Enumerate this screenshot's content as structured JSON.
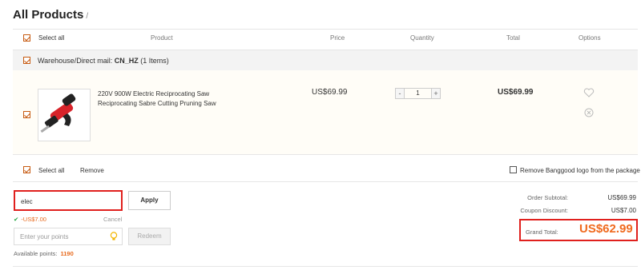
{
  "page": {
    "title": "All Products",
    "title_sep": "/"
  },
  "table_header": {
    "select_all": "Select all",
    "product": "Product",
    "price": "Price",
    "quantity": "Quantity",
    "total": "Total",
    "options": "Options"
  },
  "warehouse": {
    "prefix": "Warehouse/Direct mail: ",
    "code": "CN_HZ",
    "count": "(1 Items)"
  },
  "item": {
    "name": "220V 900W Electric Reciprocating Saw Reciprocating Sabre Cutting Pruning Saw",
    "price": "US$69.99",
    "quantity": "1",
    "total": "US$69.99",
    "minus": "-",
    "plus": "+"
  },
  "bottom_bar": {
    "select_all": "Select all",
    "remove": "Remove",
    "remove_logo": "Remove Banggood logo from the package"
  },
  "coupon": {
    "value": "elec",
    "apply": "Apply",
    "discount": "-US$7.00",
    "cancel": "Cancel"
  },
  "points": {
    "placeholder": "Enter your points",
    "redeem": "Redeem",
    "available_label": "Available points:",
    "available_value": "1190"
  },
  "summary": {
    "subtotal_label": "Order Subtotal:",
    "subtotal_value": "US$69.99",
    "coupon_label": "Coupon Discount:",
    "coupon_value": "US$7.00",
    "grand_label": "Grand Total:",
    "grand_value": "US$62.99"
  },
  "colors": {
    "accent_orange": "#f06a1e",
    "highlight_red": "#e0201d",
    "success_green": "#1ea33d"
  }
}
